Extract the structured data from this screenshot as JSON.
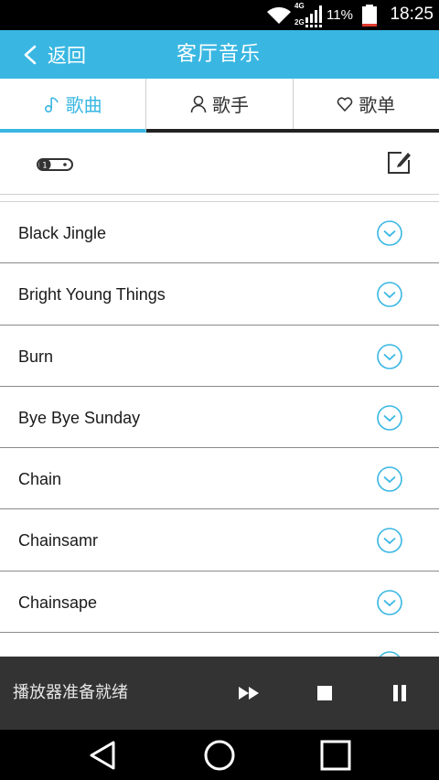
{
  "status_bar": {
    "time": "18:25",
    "battery_percent": "11%",
    "network_top": "4G",
    "network_bottom": "2G"
  },
  "header": {
    "back_label": "返回",
    "title": "客厅音乐"
  },
  "tabs": [
    {
      "label": "歌曲",
      "icon": "music-note-icon",
      "active": true
    },
    {
      "label": "歌手",
      "icon": "person-icon",
      "active": false
    },
    {
      "label": "歌单",
      "icon": "heart-icon",
      "active": false
    }
  ],
  "songs": [
    "Black Jingle",
    "Bright Young Things",
    "Burn",
    "Bye Bye Sunday",
    "Chain",
    "Chainsamr",
    "Chainsape"
  ],
  "player": {
    "status": "播放器准备就绪"
  },
  "colors": {
    "accent": "#39b7e2",
    "player_bg": "#333333"
  }
}
